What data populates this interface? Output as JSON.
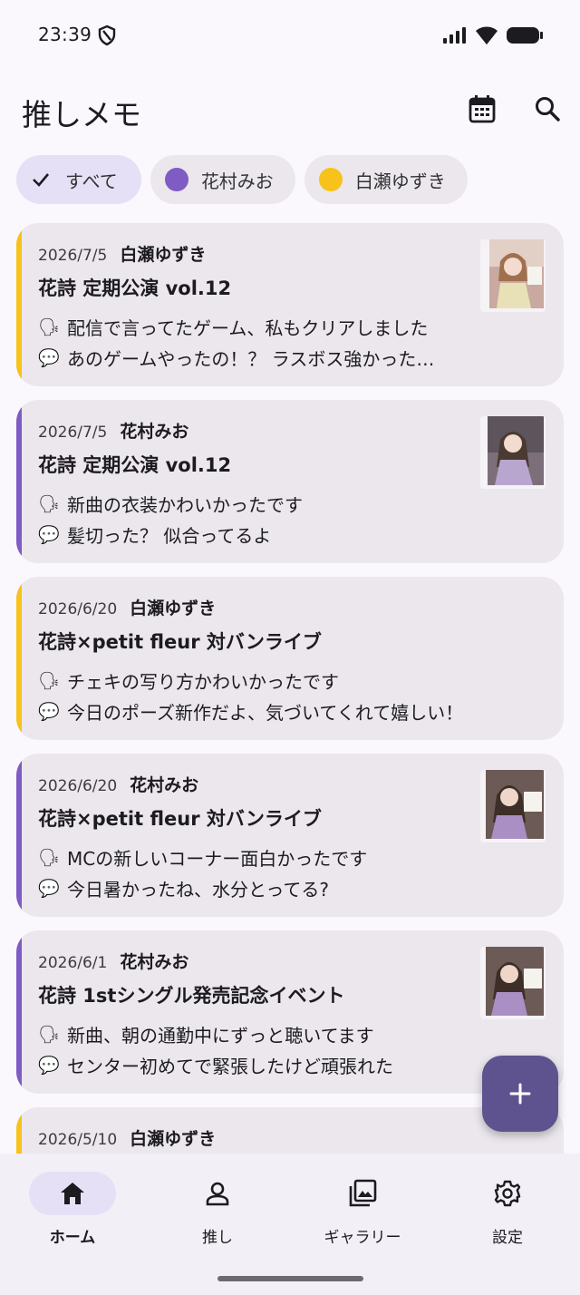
{
  "status_bar": {
    "time": "23:39"
  },
  "app": {
    "title": "推しメモ"
  },
  "colors": {
    "accent": "#5e538f",
    "member_mio": "#7e5cc4",
    "member_yuzuki": "#f7c21a"
  },
  "filters": [
    {
      "label": "すべて",
      "icon": "check-icon"
    },
    {
      "label": "花村みお",
      "color": "#7e5cc4"
    },
    {
      "label": "白瀬ゆずき",
      "color": "#f7c21a"
    }
  ],
  "memos": [
    {
      "date": "2026/7/5",
      "member": "白瀬ゆずき",
      "event": "花詩 定期公演 vol.12",
      "said": "配信で言ってたゲーム、私もクリアしました",
      "reply": "あのゲームやったの！？ ラスボス強かった…",
      "has_photo": true,
      "accent": "#f7c21a"
    },
    {
      "date": "2026/7/5",
      "member": "花村みお",
      "event": "花詩 定期公演 vol.12",
      "said": "新曲の衣装かわいかったです",
      "reply": "髪切った？ 似合ってるよ",
      "has_photo": true,
      "accent": "#7e5cc4"
    },
    {
      "date": "2026/6/20",
      "member": "白瀬ゆずき",
      "event": "花詩×petit fleur 対バンライブ",
      "said": "チェキの写り方かわいかったです",
      "reply": "今日のポーズ新作だよ、気づいてくれて嬉しい！",
      "has_photo": false,
      "accent": "#f7c21a"
    },
    {
      "date": "2026/6/20",
      "member": "花村みお",
      "event": "花詩×petit fleur 対バンライブ",
      "said": "MCの新しいコーナー面白かったです",
      "reply": "今日暑かったね、水分とってる?",
      "has_photo": true,
      "accent": "#7e5cc4"
    },
    {
      "date": "2026/6/1",
      "member": "花村みお",
      "event": "花詩 1stシングル発売記念イベント",
      "said": "新曲、朝の通勤中にずっと聴いてます",
      "reply": "センター初めてで緊張したけど頑張れた",
      "has_photo": true,
      "accent": "#7e5cc4"
    },
    {
      "date": "2026/5/10",
      "member": "白瀬ゆずき",
      "event": "",
      "said": "",
      "reply": "",
      "has_photo": false,
      "accent": "#f7c21a"
    }
  ],
  "bottom_nav": [
    {
      "label": "ホーム",
      "icon": "home-icon",
      "active": true
    },
    {
      "label": "推し",
      "icon": "person-icon",
      "active": false
    },
    {
      "label": "ギャラリー",
      "icon": "gallery-icon",
      "active": false
    },
    {
      "label": "設定",
      "icon": "gear-icon",
      "active": false
    }
  ]
}
